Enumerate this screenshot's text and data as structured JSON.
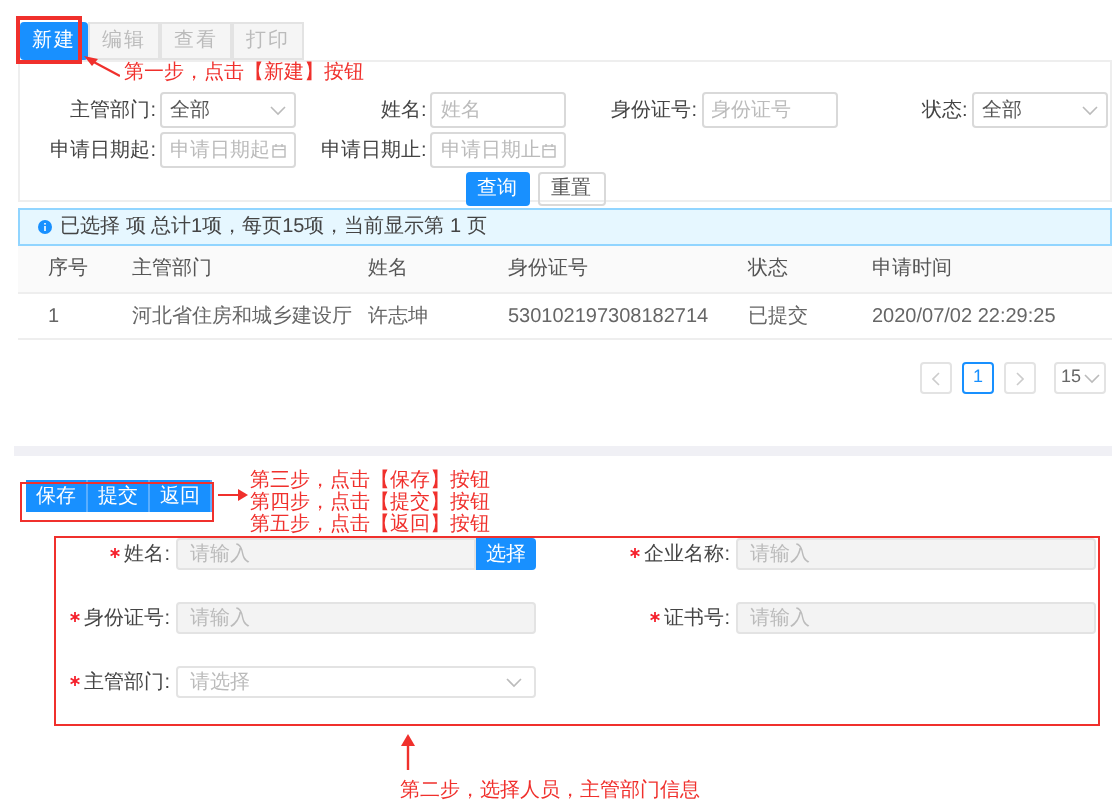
{
  "toolbar": [
    {
      "label": "新建",
      "disabled": false
    },
    {
      "label": "编辑",
      "disabled": true
    },
    {
      "label": "查看",
      "disabled": true
    },
    {
      "label": "打印",
      "disabled": true
    }
  ],
  "filters": [
    {
      "label": "主管部门:",
      "kind": "select",
      "value": "全部"
    },
    {
      "label": "姓名:",
      "kind": "text",
      "placeholder": "姓名"
    },
    {
      "label": "身份证号:",
      "kind": "text",
      "placeholder": "身份证号"
    },
    {
      "label": "状态:",
      "kind": "select",
      "value": "全部"
    },
    {
      "label": "申请日期起:",
      "kind": "date",
      "placeholder": "申请日期起"
    },
    {
      "label": "申请日期止:",
      "kind": "date",
      "placeholder": "申请日期止"
    }
  ],
  "filter_actions": {
    "query": "查询",
    "reset": "重置"
  },
  "alert": "已选择 项 总计1项，每页15项，当前显示第 1 页",
  "table": {
    "columns": [
      "序号",
      "主管部门",
      "姓名",
      "身份证号",
      "状态",
      "申请时间"
    ],
    "rows": [
      [
        "1",
        "河北省住房和城乡建设厅",
        "许志坤",
        "530102197308182714",
        "已提交",
        "2020/07/02 22:29:25"
      ]
    ]
  },
  "pagination": {
    "pages": [
      {
        "label": "1",
        "selected": true
      }
    ],
    "page_size": "15"
  },
  "form_toolbar": [
    "保存",
    "提交",
    "返回"
  ],
  "form_fields": [
    {
      "label": "姓名:",
      "required": true,
      "kind": "text",
      "placeholder": "请输入",
      "action": "选择"
    },
    {
      "label": "企业名称:",
      "required": true,
      "kind": "text",
      "placeholder": "请输入"
    },
    {
      "label": "身份证号:",
      "required": true,
      "kind": "text",
      "placeholder": "请输入"
    },
    {
      "label": "证书号:",
      "required": true,
      "kind": "text",
      "placeholder": "请输入"
    },
    {
      "label": "主管部门:",
      "required": true,
      "kind": "select",
      "placeholder": "请选择"
    }
  ],
  "annotations": {
    "step_one": "第一步，点击【新建】按钮",
    "steps_toolbar": [
      "第三步，点击【保存】按钮",
      "第四步，点击【提交】按钮",
      "第五步，点击【返回】按钮"
    ],
    "step_two": "第二步，选择人员，主管部门信息"
  }
}
